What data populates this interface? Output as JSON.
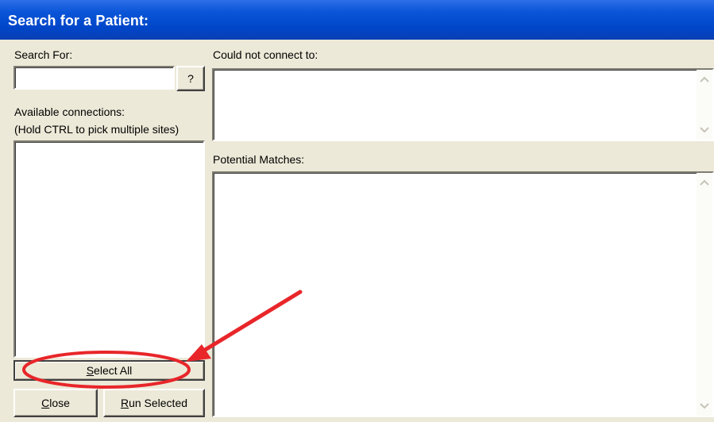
{
  "window": {
    "title": "Search for a Patient:"
  },
  "left": {
    "search_label": "Search For:",
    "search_value": "",
    "help_button": "?",
    "connections_label": "Available connections:",
    "connections_hint": "(Hold CTRL to pick multiple sites)",
    "connections": []
  },
  "right": {
    "could_not_connect_label": "Could not connect to:",
    "potential_matches_label": "Potential Matches:"
  },
  "buttons": {
    "select_all": {
      "prefix": "",
      "mnemonic": "S",
      "rest": "elect All"
    },
    "close": {
      "prefix": "",
      "mnemonic": "C",
      "rest": "lose"
    },
    "run_selected": {
      "prefix": "",
      "mnemonic": "R",
      "rest": "un Selected"
    }
  },
  "annotation": {
    "highlight_color": "#e8262a"
  },
  "icons": {
    "scroll_up": "chevron-up-icon",
    "scroll_down": "chevron-down-icon"
  }
}
